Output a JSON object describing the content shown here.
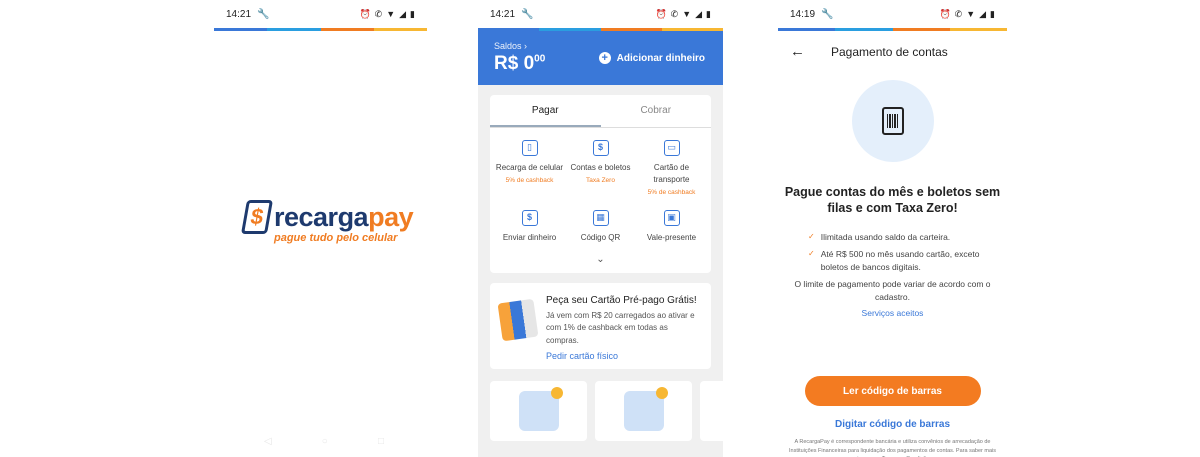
{
  "brand_colors": {
    "blue": "#3a78d8",
    "navy": "#1e3a6e",
    "orange": "#f07c22",
    "stripe": [
      "#3a78d8",
      "#2a9ee0",
      "#f07c22",
      "#f7b733"
    ]
  },
  "screen1": {
    "time": "14:21",
    "logo": {
      "mark": "$",
      "text_main": "recarga",
      "text_accent": "pay",
      "tagline": "pague tudo pelo celular"
    }
  },
  "screen2": {
    "time": "14:21",
    "balance": {
      "label": "Saldos",
      "amount_main": "R$ 0",
      "amount_cents": "00"
    },
    "add_money_label": "Adicionar dinheiro",
    "tabs": [
      "Pagar",
      "Cobrar"
    ],
    "services": [
      {
        "label": "Recarga de celular",
        "sub": "5% de cashback",
        "icon": "phone-icon"
      },
      {
        "label": "Contas e boletos",
        "sub": "Taxa Zero",
        "icon": "bill-icon"
      },
      {
        "label": "Cartão de transporte",
        "sub": "5% de cashback",
        "icon": "bus-icon"
      },
      {
        "label": "Enviar dinheiro",
        "sub": "",
        "icon": "send-money-icon"
      },
      {
        "label": "Código QR",
        "sub": "",
        "icon": "qr-code-icon"
      },
      {
        "label": "Vale-presente",
        "sub": "",
        "icon": "gift-icon"
      }
    ],
    "promo": {
      "title": "Peça seu Cartão Pré-pago Grátis!",
      "body": "Já vem com R$ 20 carregados ao ativar e com 1% de cashback em todas as compras.",
      "link": "Pedir cartão físico"
    }
  },
  "screen3": {
    "time": "14:19",
    "title": "Pagamento de contas",
    "heading": "Pague contas do mês e boletos sem filas e com Taxa Zero!",
    "checks": [
      "Ilimitada usando saldo da carteira.",
      "Até R$ 500 no mês usando cartão, exceto boletos de bancos digitais."
    ],
    "limit_note": "O limite de pagamento pode variar de acordo com o cadastro.",
    "services_link": "Serviços aceitos",
    "primary_button": "Ler código de barras",
    "secondary_link": "Digitar código de barras",
    "disclaimer": "A RecargaPay é correspondente bancária e utiliza convênios de arrecadação de Instituições Financeiras para liquidação dos pagamentos de contas. Para saber mais veja nossos Termos e Condições."
  }
}
